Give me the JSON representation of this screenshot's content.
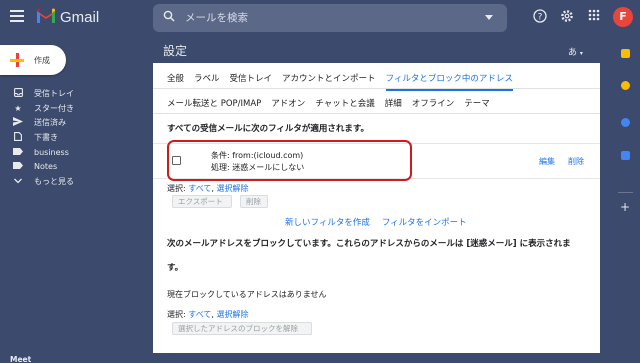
{
  "app": {
    "name": "Gmail",
    "logo_letter": "M"
  },
  "search": {
    "placeholder": "メールを検索"
  },
  "user": {
    "avatar_letter": "F"
  },
  "compose": {
    "label": "作成"
  },
  "sidebar": {
    "items": [
      {
        "label": "受信トレイ",
        "icon": "inbox-icon"
      },
      {
        "label": "スター付き",
        "icon": "star-icon"
      },
      {
        "label": "送信済み",
        "icon": "send-icon"
      },
      {
        "label": "下書き",
        "icon": "draft-icon"
      },
      {
        "label": "business",
        "icon": "label-icon"
      },
      {
        "label": "Notes",
        "icon": "label-icon"
      },
      {
        "label": "もっと見る",
        "icon": "chevron-down-icon"
      }
    ],
    "meet": "Meet"
  },
  "settings": {
    "title": "設定",
    "lang_indicator": "あ",
    "tabs_row1": [
      "全般",
      "ラベル",
      "受信トレイ",
      "アカウントとインポート",
      "フィルタとブロック中のアドレス"
    ],
    "tabs_row2": [
      "メール転送と POP/IMAP",
      "アドオン",
      "チャットと会議",
      "詳細",
      "オフライン",
      "テーマ"
    ],
    "active_tab": "フィルタとブロック中のアドレス"
  },
  "filters": {
    "heading": "すべての受信メールに次のフィルタが適用されます。",
    "items": [
      {
        "condition": "条件: from:(icloud.com)",
        "action": "処理: 迷惑メールにしない",
        "edit": "編集",
        "delete": "削除"
      }
    ],
    "select_label": "選択:",
    "select_all": "すべて",
    "select_none": "選択解除",
    "export_button": "エクスポート",
    "delete_button": "削除",
    "create_filter": "新しいフィルタを作成",
    "import_filter": "フィルタをインポート"
  },
  "blocked": {
    "heading_line1": "次のメールアドレスをブロックしています。これらのアドレスからのメールは [迷惑メール] に表示されま",
    "heading_line2": "す。",
    "none": "現在ブロックしているアドレスはありません",
    "select_label": "選択:",
    "select_all": "すべて",
    "select_none": "選択解除",
    "unblock_button": "選択したアドレスのブロックを解除"
  },
  "colors": {
    "background": "#3c4a6d",
    "accent": "#1a73e8",
    "highlight": "#d11a1a"
  }
}
